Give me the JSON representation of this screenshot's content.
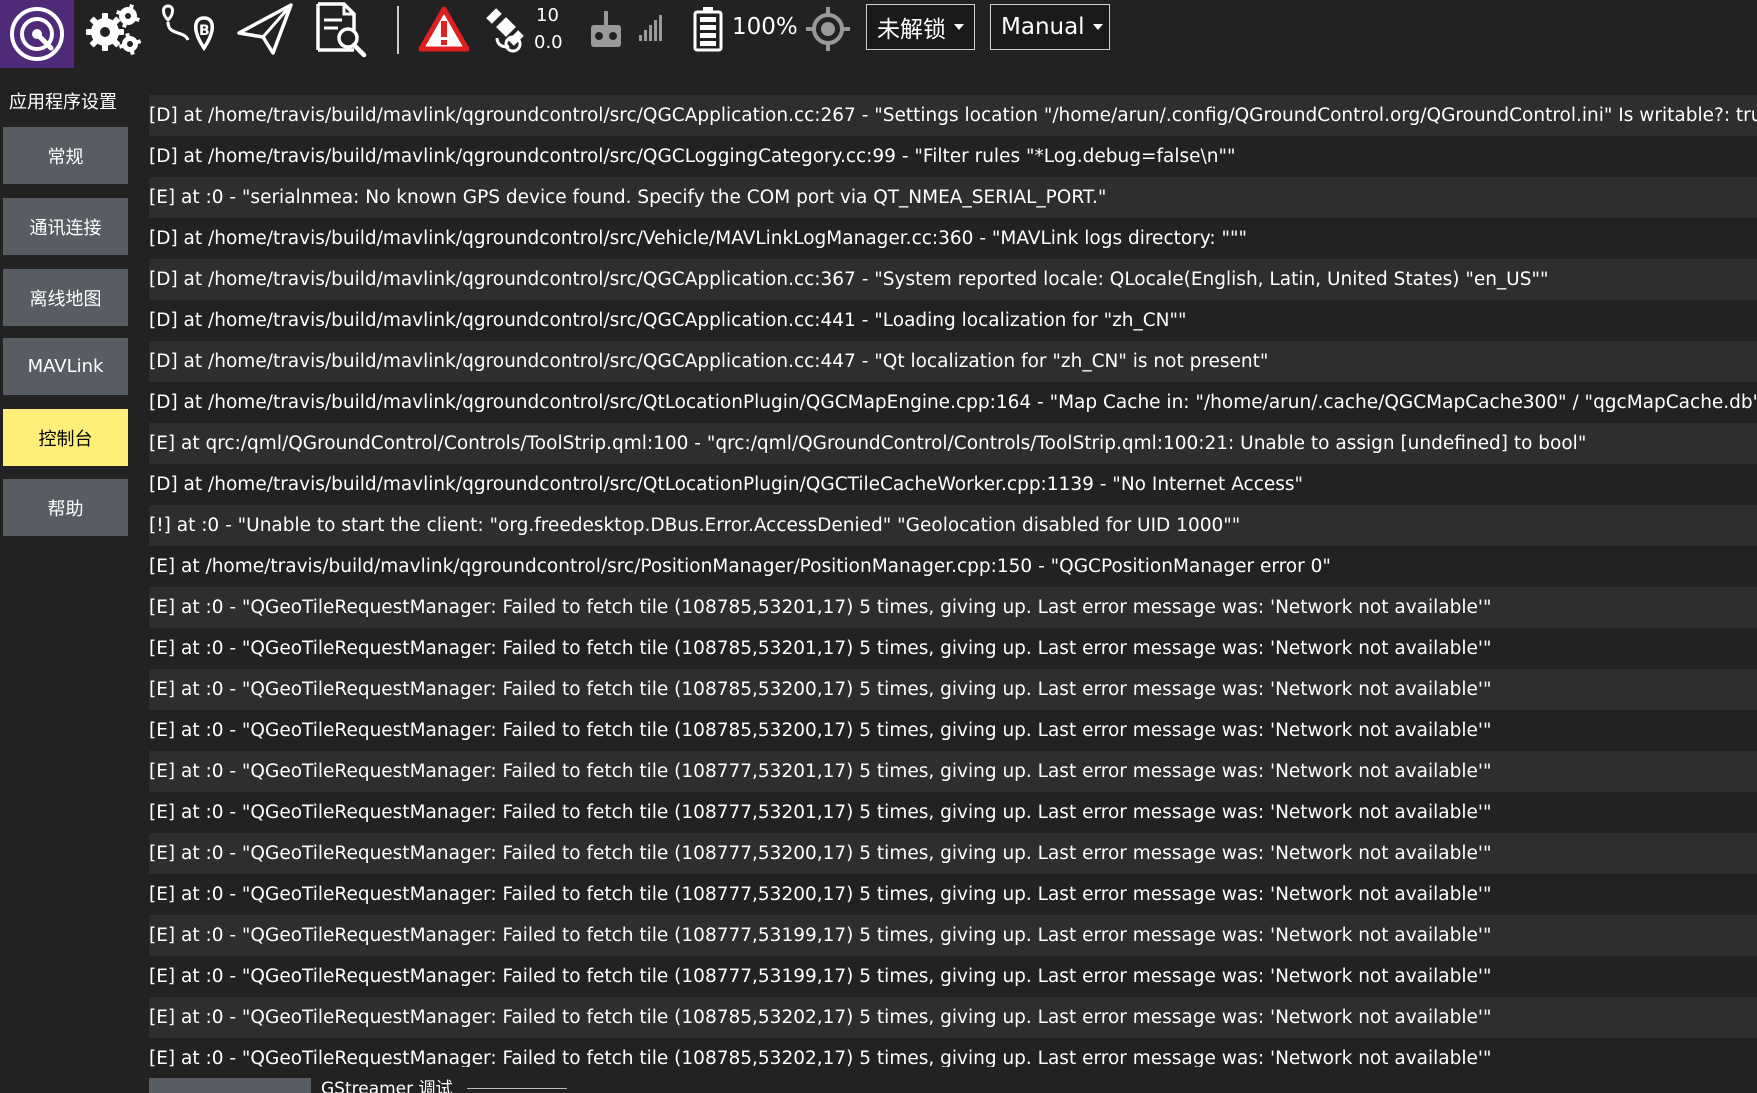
{
  "toolbar": {
    "satellite_count": "10",
    "hdop": "0.0",
    "battery_percent": "100%",
    "arm_state": "未解锁",
    "flight_mode": "Manual",
    "icons": [
      "qgc-logo-icon",
      "gear-icon",
      "plan-icon",
      "fly-icon",
      "analyze-icon",
      "warning-icon",
      "gps-icon",
      "rc-icon",
      "signal-icon",
      "battery-icon",
      "rtk-icon"
    ],
    "warning_color": "#e02020"
  },
  "sidebar": {
    "title": "应用程序设置",
    "items": [
      {
        "label": "常规"
      },
      {
        "label": "通讯连接"
      },
      {
        "label": "离线地图"
      },
      {
        "label": "MAVLink"
      },
      {
        "label": "控制台",
        "active": true
      },
      {
        "label": "帮助"
      }
    ]
  },
  "console": {
    "lines": [
      "[D] at /home/travis/build/mavlink/qgroundcontrol/src/QGCApplication.cc:267 - \"Settings location \"/home/arun/.config/QGroundControl.org/QGroundControl.ini\" Is writable?: true\"",
      "[D] at /home/travis/build/mavlink/qgroundcontrol/src/QGCLoggingCategory.cc:99 - \"Filter rules \"*Log.debug=false\\n\"\"",
      "[E] at :0 - \"serialnmea: No known GPS device found. Specify the COM port via QT_NMEA_SERIAL_PORT.\"",
      "[D] at /home/travis/build/mavlink/qgroundcontrol/src/Vehicle/MAVLinkLogManager.cc:360 - \"MAVLink logs directory: \"\"\"",
      "[D] at /home/travis/build/mavlink/qgroundcontrol/src/QGCApplication.cc:367 - \"System reported locale: QLocale(English, Latin, United States) \"en_US\"\"",
      "[D] at /home/travis/build/mavlink/qgroundcontrol/src/QGCApplication.cc:441 - \"Loading localization for \"zh_CN\"\"",
      "[D] at /home/travis/build/mavlink/qgroundcontrol/src/QGCApplication.cc:447 - \"Qt localization for \"zh_CN\" is not present\"",
      "[D] at /home/travis/build/mavlink/qgroundcontrol/src/QtLocationPlugin/QGCMapEngine.cpp:164 - \"Map Cache in: \"/home/arun/.cache/QGCMapCache300\" / \"qgcMapCache.db\"\"",
      "[E] at qrc:/qml/QGroundControl/Controls/ToolStrip.qml:100 - \"qrc:/qml/QGroundControl/Controls/ToolStrip.qml:100:21: Unable to assign [undefined] to bool\"",
      "[D] at /home/travis/build/mavlink/qgroundcontrol/src/QtLocationPlugin/QGCTileCacheWorker.cpp:1139 - \"No Internet Access\"",
      "[!] at :0 - \"Unable to start the client: \"org.freedesktop.DBus.Error.AccessDenied\" \"Geolocation disabled for UID 1000\"\"",
      "[E] at /home/travis/build/mavlink/qgroundcontrol/src/PositionManager/PositionManager.cpp:150 - \"QGCPositionManager error 0\"",
      "[E] at :0 - \"QGeoTileRequestManager: Failed to fetch tile (108785,53201,17) 5 times, giving up. Last error message was: 'Network not available'\"",
      "[E] at :0 - \"QGeoTileRequestManager: Failed to fetch tile (108785,53201,17) 5 times, giving up. Last error message was: 'Network not available'\"",
      "[E] at :0 - \"QGeoTileRequestManager: Failed to fetch tile (108785,53200,17) 5 times, giving up. Last error message was: 'Network not available'\"",
      "[E] at :0 - \"QGeoTileRequestManager: Failed to fetch tile (108785,53200,17) 5 times, giving up. Last error message was: 'Network not available'\"",
      "[E] at :0 - \"QGeoTileRequestManager: Failed to fetch tile (108777,53201,17) 5 times, giving up. Last error message was: 'Network not available'\"",
      "[E] at :0 - \"QGeoTileRequestManager: Failed to fetch tile (108777,53201,17) 5 times, giving up. Last error message was: 'Network not available'\"",
      "[E] at :0 - \"QGeoTileRequestManager: Failed to fetch tile (108777,53200,17) 5 times, giving up. Last error message was: 'Network not available'\"",
      "[E] at :0 - \"QGeoTileRequestManager: Failed to fetch tile (108777,53200,17) 5 times, giving up. Last error message was: 'Network not available'\"",
      "[E] at :0 - \"QGeoTileRequestManager: Failed to fetch tile (108777,53199,17) 5 times, giving up. Last error message was: 'Network not available'\"",
      "[E] at :0 - \"QGeoTileRequestManager: Failed to fetch tile (108777,53199,17) 5 times, giving up. Last error message was: 'Network not available'\"",
      "[E] at :0 - \"QGeoTileRequestManager: Failed to fetch tile (108785,53202,17) 5 times, giving up. Last error message was: 'Network not available'\"",
      "[E] at :0 - \"QGeoTileRequestManager: Failed to fetch tile (108785,53202,17) 5 times, giving up. Last error message was: 'Network not available'\""
    ]
  },
  "bottom": {
    "gstreamer_label": "GStreamer 调试"
  }
}
